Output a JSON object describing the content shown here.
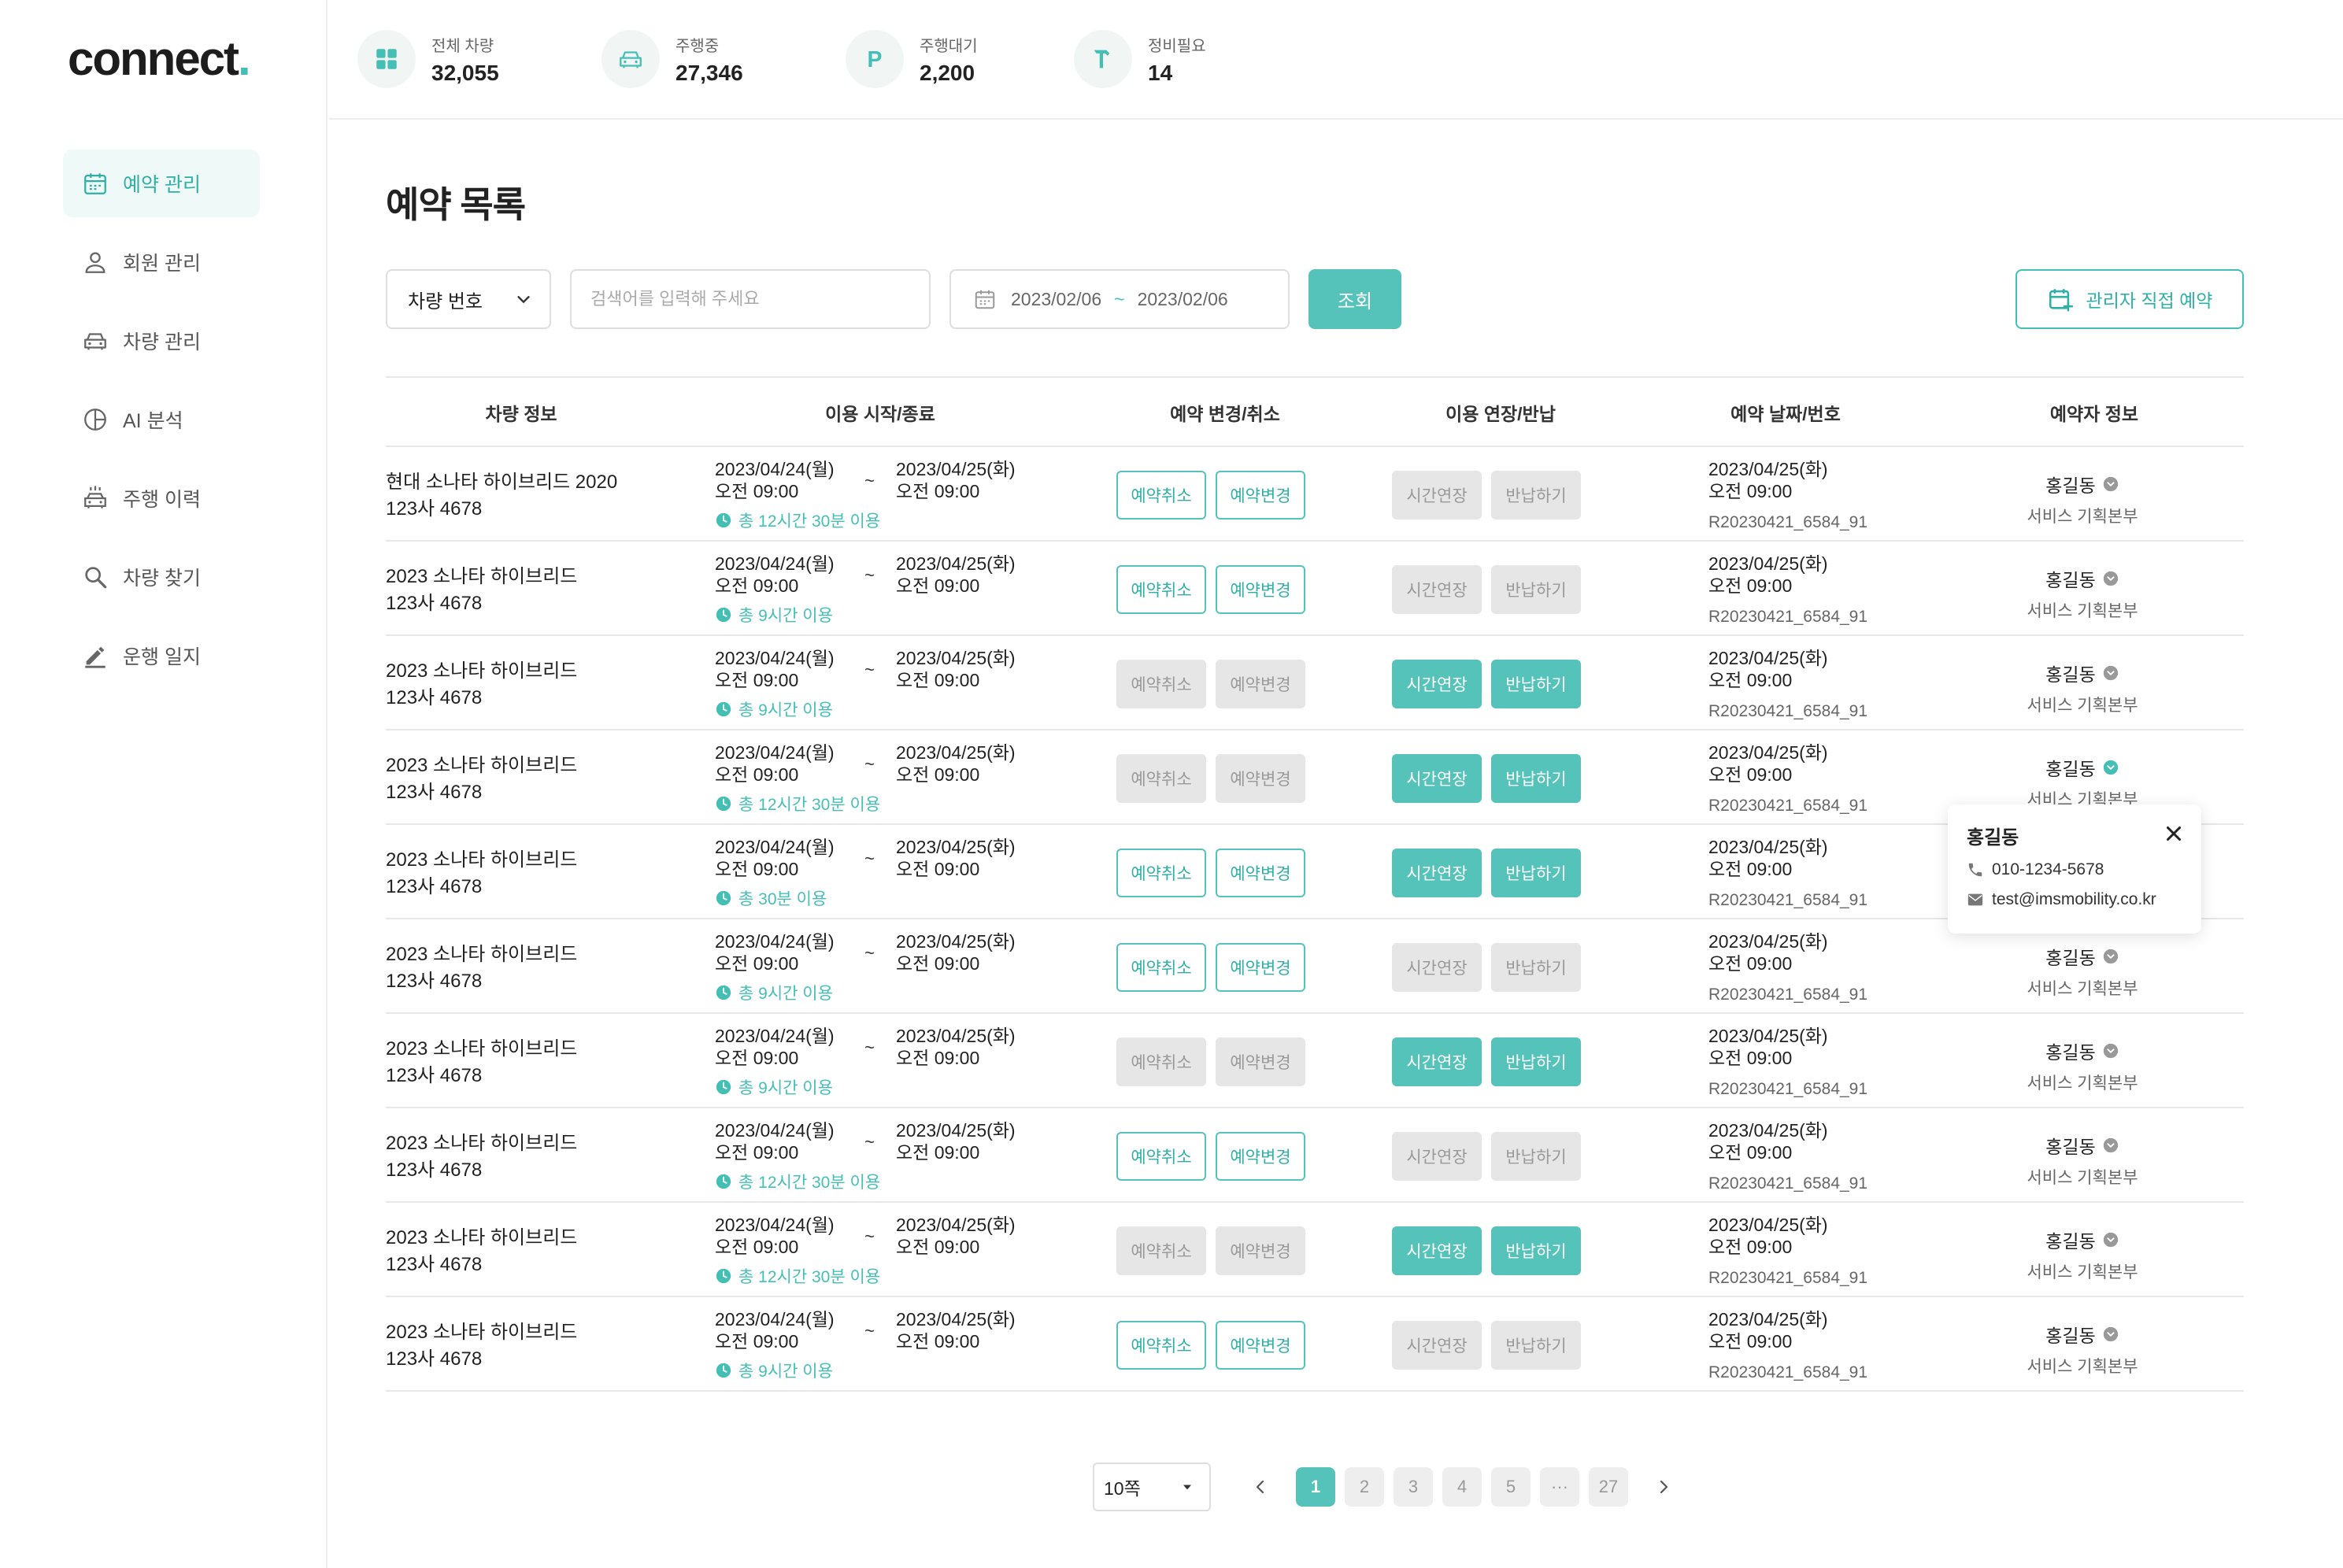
{
  "logo": {
    "text": "connect",
    "dot": "."
  },
  "nav": [
    {
      "label": "예약 관리",
      "icon": "calendar-icon",
      "active": true
    },
    {
      "label": "회원 관리",
      "icon": "user-icon",
      "active": false
    },
    {
      "label": "차량 관리",
      "icon": "car-icon",
      "active": false
    },
    {
      "label": "AI 분석",
      "icon": "pie-chart-icon",
      "active": false
    },
    {
      "label": "주행 이력",
      "icon": "car-history-icon",
      "active": false
    },
    {
      "label": "차량 찾기",
      "icon": "search-icon",
      "active": false
    },
    {
      "label": "운행 일지",
      "icon": "pen-icon",
      "active": false
    }
  ],
  "stats": [
    {
      "label": "전체 차량",
      "value": "32,055",
      "icon": "grid-icon"
    },
    {
      "label": "주행중",
      "value": "27,346",
      "icon": "car-icon"
    },
    {
      "label": "주행대기",
      "value": "2,200",
      "icon": "parking-icon"
    },
    {
      "label": "정비필요",
      "value": "14",
      "icon": "hammer-icon"
    }
  ],
  "page_title": "예약 목록",
  "filters": {
    "select_value": "차량 번호",
    "search_placeholder": "검색어를 입력해 주세요",
    "date_from": "2023/02/06",
    "date_sep": "~",
    "date_to": "2023/02/06",
    "search_button": "조회",
    "admin_button": "관리자 직접 예약"
  },
  "table": {
    "headers": [
      "차량 정보",
      "이용 시작/종료",
      "예약 변경/취소",
      "이용 연장/반납",
      "예약 날짜/번호",
      "예약자 정보"
    ],
    "rows": [
      {
        "car": "현대 소나타 하이브리드 2020",
        "plate": "123사 4678",
        "start_date": "2023/04/24(월)",
        "start_time": "오전 09:00",
        "sep": "~",
        "end_date": "2023/04/25(화)",
        "end_time": "오전 09:00",
        "usage": "총 12시간 30분 이용",
        "cancel": "예약취소",
        "change": "예약변경",
        "resv_active": true,
        "extend": "시간연장",
        "return": "반납하기",
        "extend_active": false,
        "resv_date": "2023/04/25(화)",
        "resv_time": "오전 09:00",
        "resv_id": "R20230421_6584_91",
        "user": "홍길동",
        "dept": "서비스 기획본부",
        "user_verified": false
      },
      {
        "car": "2023 소나타 하이브리드",
        "plate": "123사 4678",
        "start_date": "2023/04/24(월)",
        "start_time": "오전 09:00",
        "sep": "~",
        "end_date": "2023/04/25(화)",
        "end_time": "오전 09:00",
        "usage": "총 9시간 이용",
        "cancel": "예약취소",
        "change": "예약변경",
        "resv_active": true,
        "extend": "시간연장",
        "return": "반납하기",
        "extend_active": false,
        "resv_date": "2023/04/25(화)",
        "resv_time": "오전 09:00",
        "resv_id": "R20230421_6584_91",
        "user": "홍길동",
        "dept": "서비스 기획본부",
        "user_verified": false
      },
      {
        "car": "2023 소나타 하이브리드",
        "plate": "123사 4678",
        "start_date": "2023/04/24(월)",
        "start_time": "오전 09:00",
        "sep": "~",
        "end_date": "2023/04/25(화)",
        "end_time": "오전 09:00",
        "usage": "총 9시간 이용",
        "cancel": "예약취소",
        "change": "예약변경",
        "resv_active": false,
        "extend": "시간연장",
        "return": "반납하기",
        "extend_active": true,
        "resv_date": "2023/04/25(화)",
        "resv_time": "오전 09:00",
        "resv_id": "R20230421_6584_91",
        "user": "홍길동",
        "dept": "서비스 기획본부",
        "user_verified": false
      },
      {
        "car": "2023 소나타 하이브리드",
        "plate": "123사 4678",
        "start_date": "2023/04/24(월)",
        "start_time": "오전 09:00",
        "sep": "~",
        "end_date": "2023/04/25(화)",
        "end_time": "오전 09:00",
        "usage": "총 12시간 30분 이용",
        "cancel": "예약취소",
        "change": "예약변경",
        "resv_active": false,
        "extend": "시간연장",
        "return": "반납하기",
        "extend_active": true,
        "resv_date": "2023/04/25(화)",
        "resv_time": "오전 09:00",
        "resv_id": "R20230421_6584_91",
        "user": "홍길동",
        "dept": "서비스 기획본부",
        "user_verified": true
      },
      {
        "car": "2023 소나타 하이브리드",
        "plate": "123사 4678",
        "start_date": "2023/04/24(월)",
        "start_time": "오전 09:00",
        "sep": "~",
        "end_date": "2023/04/25(화)",
        "end_time": "오전 09:00",
        "usage": "총 30분 이용",
        "cancel": "예약취소",
        "change": "예약변경",
        "resv_active": true,
        "extend": "시간연장",
        "return": "반납하기",
        "extend_active": true,
        "resv_date": "2023/04/25(화)",
        "resv_time": "오전 09:00",
        "resv_id": "R20230421_6584_91",
        "user": "",
        "dept": "",
        "user_verified": false
      },
      {
        "car": "2023 소나타 하이브리드",
        "plate": "123사 4678",
        "start_date": "2023/04/24(월)",
        "start_time": "오전 09:00",
        "sep": "~",
        "end_date": "2023/04/25(화)",
        "end_time": "오전 09:00",
        "usage": "총 9시간 이용",
        "cancel": "예약취소",
        "change": "예약변경",
        "resv_active": true,
        "extend": "시간연장",
        "return": "반납하기",
        "extend_active": false,
        "resv_date": "2023/04/25(화)",
        "resv_time": "오전 09:00",
        "resv_id": "R20230421_6584_91",
        "user": "홍길동",
        "dept": "서비스 기획본부",
        "user_verified": false
      },
      {
        "car": "2023 소나타 하이브리드",
        "plate": "123사 4678",
        "start_date": "2023/04/24(월)",
        "start_time": "오전 09:00",
        "sep": "~",
        "end_date": "2023/04/25(화)",
        "end_time": "오전 09:00",
        "usage": "총 9시간 이용",
        "cancel": "예약취소",
        "change": "예약변경",
        "resv_active": false,
        "extend": "시간연장",
        "return": "반납하기",
        "extend_active": true,
        "resv_date": "2023/04/25(화)",
        "resv_time": "오전 09:00",
        "resv_id": "R20230421_6584_91",
        "user": "홍길동",
        "dept": "서비스 기획본부",
        "user_verified": false
      },
      {
        "car": "2023 소나타 하이브리드",
        "plate": "123사 4678",
        "start_date": "2023/04/24(월)",
        "start_time": "오전 09:00",
        "sep": "~",
        "end_date": "2023/04/25(화)",
        "end_time": "오전 09:00",
        "usage": "총 12시간 30분 이용",
        "cancel": "예약취소",
        "change": "예약변경",
        "resv_active": true,
        "extend": "시간연장",
        "return": "반납하기",
        "extend_active": false,
        "resv_date": "2023/04/25(화)",
        "resv_time": "오전 09:00",
        "resv_id": "R20230421_6584_91",
        "user": "홍길동",
        "dept": "서비스 기획본부",
        "user_verified": false
      },
      {
        "car": "2023 소나타 하이브리드",
        "plate": "123사 4678",
        "start_date": "2023/04/24(월)",
        "start_time": "오전 09:00",
        "sep": "~",
        "end_date": "2023/04/25(화)",
        "end_time": "오전 09:00",
        "usage": "총 12시간 30분 이용",
        "cancel": "예약취소",
        "change": "예약변경",
        "resv_active": false,
        "extend": "시간연장",
        "return": "반납하기",
        "extend_active": true,
        "resv_date": "2023/04/25(화)",
        "resv_time": "오전 09:00",
        "resv_id": "R20230421_6584_91",
        "user": "홍길동",
        "dept": "서비스 기획본부",
        "user_verified": false
      },
      {
        "car": "2023 소나타 하이브리드",
        "plate": "123사 4678",
        "start_date": "2023/04/24(월)",
        "start_time": "오전 09:00",
        "sep": "~",
        "end_date": "2023/04/25(화)",
        "end_time": "오전 09:00",
        "usage": "총 9시간 이용",
        "cancel": "예약취소",
        "change": "예약변경",
        "resv_active": true,
        "extend": "시간연장",
        "return": "반납하기",
        "extend_active": false,
        "resv_date": "2023/04/25(화)",
        "resv_time": "오전 09:00",
        "resv_id": "R20230421_6584_91",
        "user": "홍길동",
        "dept": "서비스 기획본부",
        "user_verified": false
      }
    ]
  },
  "popup": {
    "name": "홍길동",
    "phone": "010-1234-5678",
    "email": "test@imsmobility.co.kr"
  },
  "pagination": {
    "page_size": "10쪽",
    "pages": [
      "1",
      "2",
      "3",
      "4",
      "5",
      "···",
      "27"
    ],
    "current": "1"
  },
  "colors": {
    "accent": "#55c3b9",
    "accent_dark": "#2fb0a6",
    "muted_button": "#e6e6e6"
  }
}
